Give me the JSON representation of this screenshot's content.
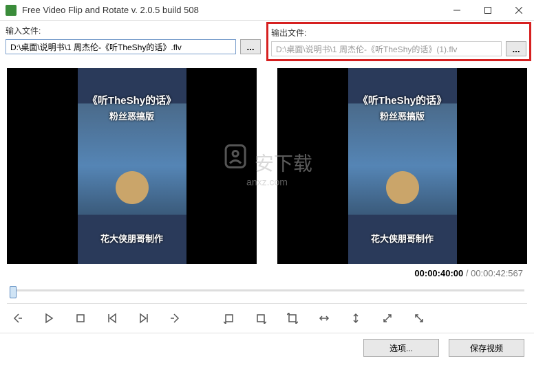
{
  "window": {
    "title": "Free Video Flip and Rotate  v. 2.0.5 build 508"
  },
  "input": {
    "label": "输入文件:",
    "path": "D:\\桌面\\说明书\\1 周杰伦-《听TheShy的话》.flv",
    "browse": "..."
  },
  "output": {
    "label": "输出文件:",
    "path": "D:\\桌面\\说明书\\1 周杰伦-《听TheShy的话》(1).flv",
    "browse": "..."
  },
  "preview": {
    "title": "《听TheShy的话》",
    "subtitle": "粉丝恶搞版",
    "credit": "花大侠朋哥制作"
  },
  "watermark": {
    "text": "安下载",
    "url": "anxz.com"
  },
  "time": {
    "current": "00:00:40:00",
    "total": "00:00:42:567"
  },
  "buttons": {
    "options": "选项...",
    "save": "保存视频"
  }
}
